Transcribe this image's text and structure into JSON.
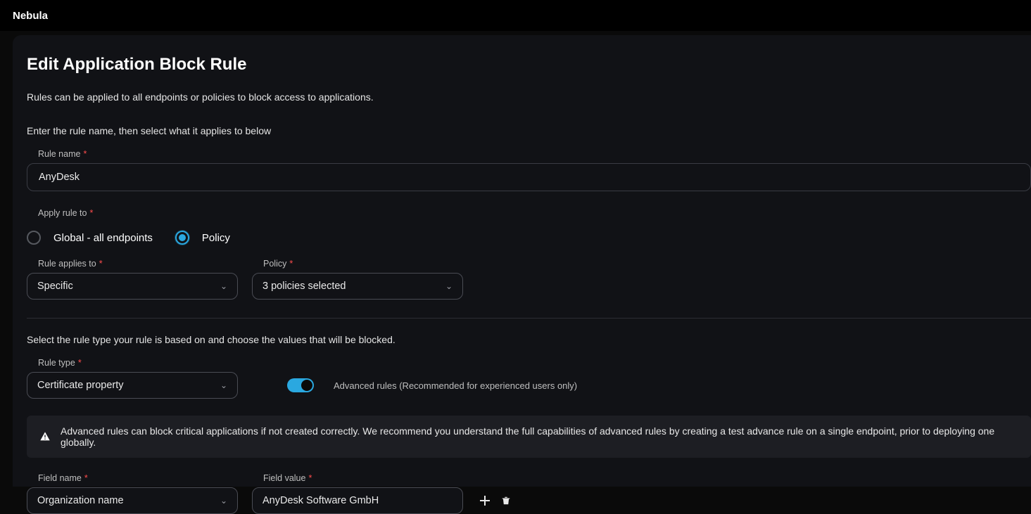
{
  "brand": "Nebula",
  "page": {
    "title": "Edit Application Block Rule",
    "description": "Rules can be applied to all endpoints or policies to block access to applications.",
    "instruction": "Enter the rule name, then select what it applies to below"
  },
  "form": {
    "rule_name_label": "Rule name",
    "rule_name_value": "AnyDesk",
    "apply_to_label": "Apply rule to",
    "radio_global": "Global - all endpoints",
    "radio_policy": "Policy",
    "radio_selected": "policy",
    "applies_to_label": "Rule applies to",
    "applies_to_value": "Specific",
    "policy_label": "Policy",
    "policy_value": "3 policies selected",
    "section2_instruction": "Select the rule type your rule is based on and choose the values that will be blocked.",
    "rule_type_label": "Rule type",
    "rule_type_value": "Certificate property",
    "advanced_toggle_on": true,
    "advanced_label": "Advanced rules (Recommended for experienced users only)",
    "warning": "Advanced rules can block critical applications if not created correctly. We recommend you understand the full capabilities of advanced rules by creating a test advance rule on a single endpoint, prior to deploying one globally.",
    "field_name_label": "Field name",
    "field_name_value": "Organization name",
    "field_value_label": "Field value",
    "field_value_value": "AnyDesk Software GmbH"
  }
}
